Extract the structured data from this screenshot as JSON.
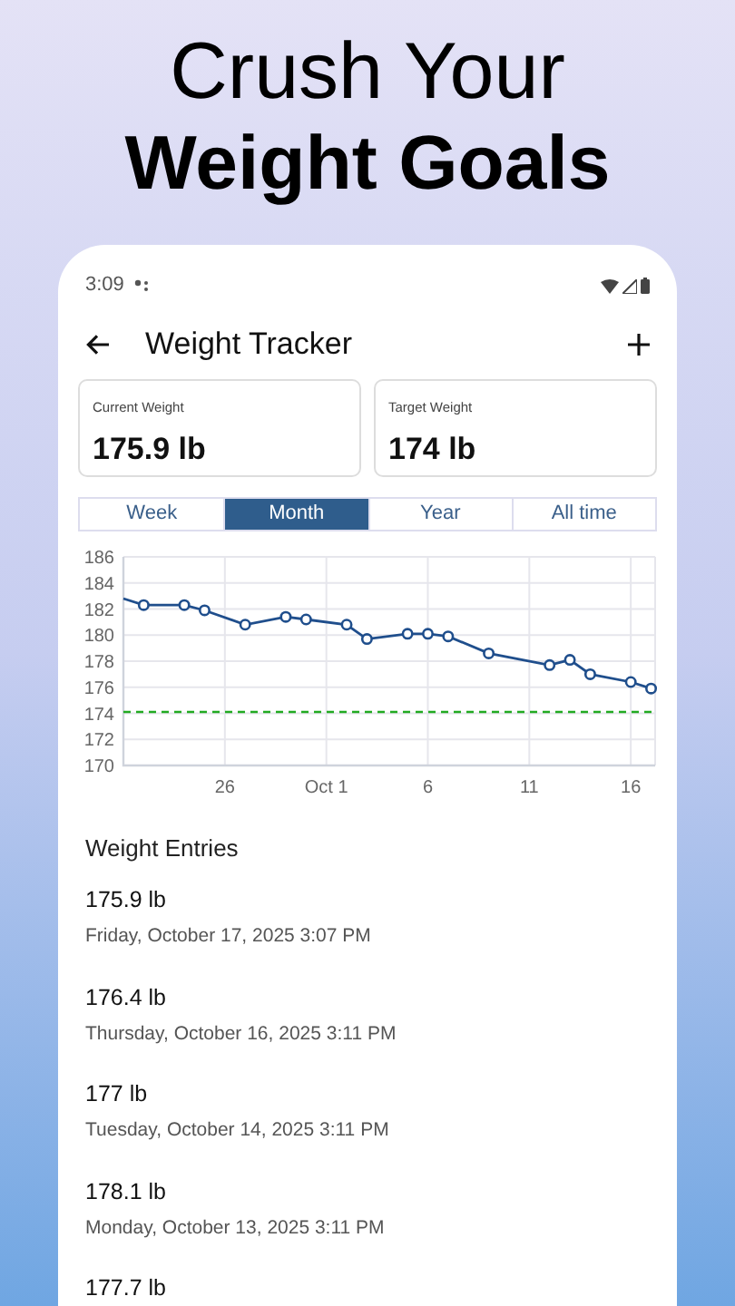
{
  "headline": {
    "line_1": "Crush Your",
    "line_2": "Weight Goals"
  },
  "status_bar": {
    "time": "3:09"
  },
  "app_bar": {
    "title": "Weight Tracker"
  },
  "stats": [
    {
      "label": "Current Weight",
      "value": "175.9 lb"
    },
    {
      "label": "Target Weight",
      "value": "174 lb"
    }
  ],
  "range_tabs": [
    {
      "label": "Week",
      "selected": false
    },
    {
      "label": "Month",
      "selected": true
    },
    {
      "label": "Year",
      "selected": false
    },
    {
      "label": "All time",
      "selected": false
    }
  ],
  "chart_data": {
    "type": "line",
    "categories": [
      null,
      null,
      null,
      null,
      null,
      "26",
      null,
      null,
      null,
      null,
      "Oct 1",
      null,
      null,
      null,
      null,
      "6",
      null,
      null,
      null,
      null,
      "11",
      null,
      null,
      null,
      null,
      "16",
      null
    ],
    "series": [
      {
        "color": "#1f4e8c",
        "marker": "o",
        "values": [
          182.8,
          182.3,
          null,
          182.3,
          181.9,
          null,
          180.8,
          null,
          181.4,
          181.2,
          null,
          180.8,
          179.7,
          null,
          180.1,
          180.1,
          179.9,
          null,
          178.6,
          null,
          null,
          177.7,
          178.1,
          177.0,
          null,
          176.4,
          175.9
        ]
      }
    ],
    "ylim": [
      170,
      186
    ],
    "yticks": [
      170,
      172,
      174,
      176,
      178,
      180,
      182,
      184,
      186
    ],
    "grid": true,
    "ref_lines": [
      {
        "value": 174.1,
        "axis": "y",
        "color": "#22aa22"
      }
    ]
  },
  "entries_title": "Weight Entries",
  "entries": [
    {
      "weight": "175.9 lb",
      "date": "Friday, October 17, 2025 3:07 PM"
    },
    {
      "weight": "176.4 lb",
      "date": "Thursday, October 16, 2025 3:11 PM"
    },
    {
      "weight": "177 lb",
      "date": "Tuesday, October 14, 2025 3:11 PM"
    },
    {
      "weight": "178.1 lb",
      "date": "Monday, October 13, 2025 3:11 PM"
    },
    {
      "weight": "177.7 lb"
    }
  ]
}
